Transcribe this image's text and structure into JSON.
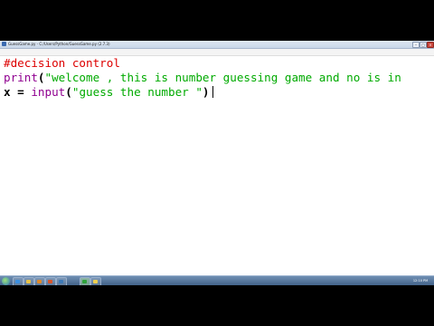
{
  "window": {
    "title": "GuessGame.py - C:/Users/Python/GuessGame.py (2.7.3)",
    "controls": {
      "minimize": "–",
      "maximize": "□",
      "close": "×"
    }
  },
  "menu": [
    "File",
    "Edit",
    "Format",
    "Run",
    "Options",
    "Windows",
    "Help"
  ],
  "code": {
    "line1_comment": "#decision control",
    "line2_func": "print",
    "line2_open": "(",
    "line2_string": "\"welcome , this is number guessing game and no is in",
    "line3_var": "x = ",
    "line3_func": "input",
    "line3_open": "(",
    "line3_string": "\"guess the number \"",
    "line3_close": ")"
  },
  "taskbar": {
    "time": "12:10 PM",
    "icons": [
      "ie-icon",
      "folder-icon",
      "media-icon",
      "firefox-icon",
      "python-icon",
      "notepad-icon",
      "idle-icon"
    ]
  },
  "colors": {
    "comment": "#dd0000",
    "builtin": "#900090",
    "string": "#00aa00",
    "text": "#000000"
  }
}
